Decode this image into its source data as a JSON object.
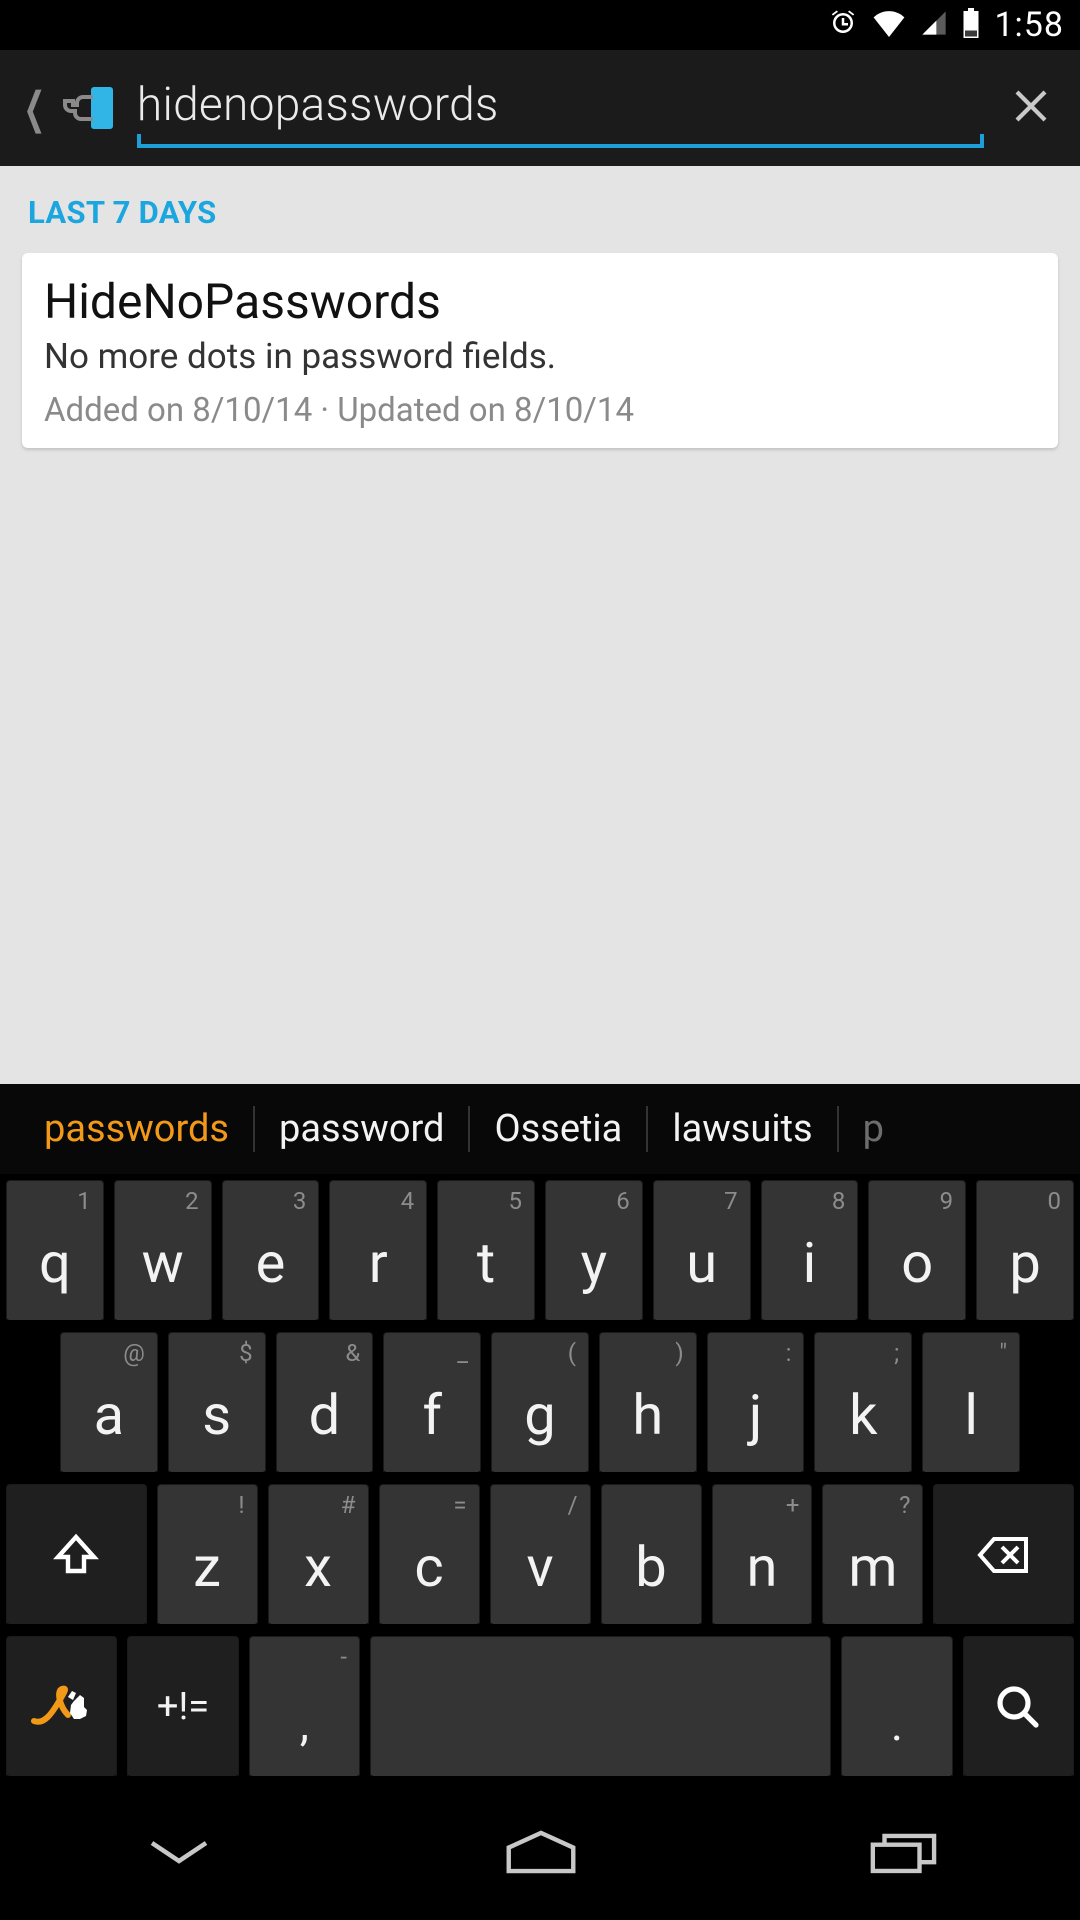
{
  "status": {
    "time": "1:58"
  },
  "search": {
    "query": "hidenopasswords"
  },
  "section_header": "LAST 7 DAYS",
  "result": {
    "title": "HideNoPasswords",
    "desc": "No more dots in password fields.",
    "meta": "Added on 8/10/14 · Updated on 8/10/14"
  },
  "suggestions": [
    "passwords",
    "password",
    "Ossetia",
    "lawsuits",
    "p"
  ],
  "kb": {
    "row1": [
      {
        "k": "q",
        "h": "1"
      },
      {
        "k": "w",
        "h": "2"
      },
      {
        "k": "e",
        "h": "3"
      },
      {
        "k": "r",
        "h": "4"
      },
      {
        "k": "t",
        "h": "5"
      },
      {
        "k": "y",
        "h": "6"
      },
      {
        "k": "u",
        "h": "7"
      },
      {
        "k": "i",
        "h": "8"
      },
      {
        "k": "o",
        "h": "9"
      },
      {
        "k": "p",
        "h": "0"
      }
    ],
    "row2": [
      {
        "k": "a",
        "h": "@"
      },
      {
        "k": "s",
        "h": "$"
      },
      {
        "k": "d",
        "h": "&"
      },
      {
        "k": "f",
        "h": "_"
      },
      {
        "k": "g",
        "h": "("
      },
      {
        "k": "h",
        "h": ")"
      },
      {
        "k": "j",
        "h": ":"
      },
      {
        "k": "k",
        "h": ";"
      },
      {
        "k": "l",
        "h": "\""
      }
    ],
    "row3": [
      {
        "k": "z",
        "h": "!"
      },
      {
        "k": "x",
        "h": "#"
      },
      {
        "k": "c",
        "h": "="
      },
      {
        "k": "v",
        "h": "/"
      },
      {
        "k": "b",
        "h": ""
      },
      {
        "k": "n",
        "h": "+"
      },
      {
        "k": "m",
        "h": "?"
      }
    ],
    "sym_label": "+!=",
    "comma": ",",
    "period": ".",
    "comma_hint": "-"
  }
}
